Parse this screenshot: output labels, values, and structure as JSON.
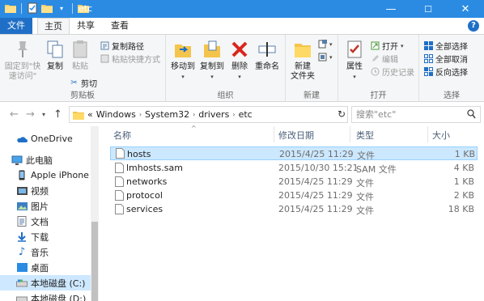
{
  "window": {
    "title": "etc",
    "controls": {
      "minimize": "—",
      "maximize": "☐",
      "close": "✕"
    }
  },
  "ribbon_tabs": {
    "file": "文件",
    "home": "主页",
    "share": "共享",
    "view": "查看",
    "help": "?"
  },
  "ribbon": {
    "clipboard": {
      "label": "剪贴板",
      "pin_line1": "固定到\"快",
      "pin_line2": "速访问\"",
      "copy": "复制",
      "paste": "粘贴",
      "cut": "剪切",
      "copy_path": "复制路径",
      "paste_shortcut": "粘贴快捷方式"
    },
    "organize": {
      "label": "组织",
      "move_to": "移动到",
      "copy_to": "复制到",
      "delete": "删除",
      "rename": "重命名"
    },
    "new": {
      "label": "新建",
      "new_folder_line1": "新建",
      "new_folder_line2": "文件夹"
    },
    "open": {
      "label": "打开",
      "properties": "属性",
      "open": "打开",
      "edit": "编辑",
      "history": "历史记录"
    },
    "select": {
      "label": "选择",
      "select_all": "全部选择",
      "select_none": "全部取消",
      "invert": "反向选择"
    }
  },
  "address": {
    "breadcrumbs": [
      "Windows",
      "System32",
      "drivers",
      "etc"
    ],
    "overflow": "«",
    "search_placeholder": "搜索\"etc\""
  },
  "nav_pane": [
    {
      "label": "OneDrive",
      "icon": "cloud-icon"
    },
    {
      "label": "此电脑",
      "icon": "computer-icon"
    },
    {
      "label": "Apple iPhone",
      "icon": "phone-icon"
    },
    {
      "label": "视频",
      "icon": "video-folder-icon"
    },
    {
      "label": "图片",
      "icon": "pictures-folder-icon"
    },
    {
      "label": "文档",
      "icon": "documents-folder-icon"
    },
    {
      "label": "下载",
      "icon": "download-icon"
    },
    {
      "label": "音乐",
      "icon": "music-icon"
    },
    {
      "label": "桌面",
      "icon": "desktop-folder-icon"
    },
    {
      "label": "本地磁盘 (C:)",
      "icon": "drive-icon"
    },
    {
      "label": "本地磁盘 (D:)",
      "icon": "drive-icon"
    }
  ],
  "file_list": {
    "columns": {
      "name": "名称",
      "modified": "修改日期",
      "type": "类型",
      "size": "大小"
    },
    "rows": [
      {
        "name": "hosts",
        "modified": "2015/4/25 11:29",
        "type": "文件",
        "size": "1 KB"
      },
      {
        "name": "lmhosts.sam",
        "modified": "2015/10/30 15:21",
        "type": "SAM 文件",
        "size": "4 KB"
      },
      {
        "name": "networks",
        "modified": "2015/4/25 11:29",
        "type": "文件",
        "size": "1 KB"
      },
      {
        "name": "protocol",
        "modified": "2015/4/25 11:29",
        "type": "文件",
        "size": "2 KB"
      },
      {
        "name": "services",
        "modified": "2015/4/25 11:29",
        "type": "文件",
        "size": "18 KB"
      }
    ]
  },
  "colors": {
    "title_bar": "#2b8be3",
    "file_tab": "#1f6fc7",
    "selection": "#cce8ff",
    "selection_border": "#99d1ff"
  }
}
